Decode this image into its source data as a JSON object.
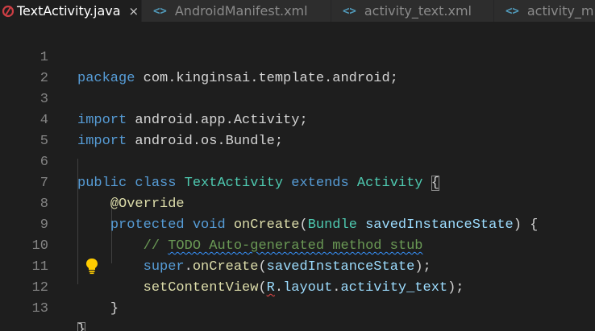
{
  "tabs": [
    {
      "label": "TextActivity.java",
      "close": "×",
      "icon": "java-file-icon",
      "active": true
    },
    {
      "label": "AndroidManifest.xml",
      "icon_glyph": "<>",
      "icon": "xml-file-icon"
    },
    {
      "label": "activity_text.xml",
      "icon_glyph": "<>",
      "icon": "xml-file-icon"
    },
    {
      "label": "activity_m",
      "icon_glyph": "<>",
      "icon": "xml-file-icon"
    }
  ],
  "editor": {
    "line_numbers": [
      "1",
      "2",
      "3",
      "4",
      "5",
      "6",
      "7",
      "8",
      "9",
      "10",
      "11",
      "12",
      "13"
    ],
    "tokens": {
      "l1_kw": "package",
      "l1_rest": " com.kinginsai.template.android;",
      "l3_kw": "import",
      "l3_rest": " android.app.Activity;",
      "l4_kw": "import",
      "l4_rest": " android.os.Bundle;",
      "l6_public": "public",
      "l6_class": "class",
      "l6_name": "TextActivity",
      "l6_extends": "extends",
      "l6_parent": "Activity",
      "l6_brace": "{",
      "l7_ann": "@Override",
      "l8_protected": "protected",
      "l8_void": "void",
      "l8_fn": "onCreate",
      "l8_open": "(",
      "l8_type": "Bundle",
      "l8_param": "savedInstanceState",
      "l8_close": ") {",
      "l9_comment_prefix": "// ",
      "l9_comment_text": "TODO Auto-generated method stub",
      "l10_super": "super",
      "l10_dot": ".",
      "l10_fn": "onCreate",
      "l10_open": "(",
      "l10_arg": "savedInstanceState",
      "l10_close": ");",
      "l11_fn": "setContentView",
      "l11_open": "(",
      "l11_r": "R",
      "l11_dot1": ".",
      "l11_layout": "layout",
      "l11_dot2": ".",
      "l11_activity": "activity_text",
      "l11_close": ");",
      "l12_brace": "}",
      "l13_brace": "}"
    },
    "hint": "lightbulb-icon"
  },
  "colors": {
    "background": "#1e1e1e",
    "keyword": "#569cd6",
    "type": "#4ec9b0",
    "function": "#dcdcaa",
    "variable": "#9cdcfe",
    "comment": "#6a9955"
  }
}
